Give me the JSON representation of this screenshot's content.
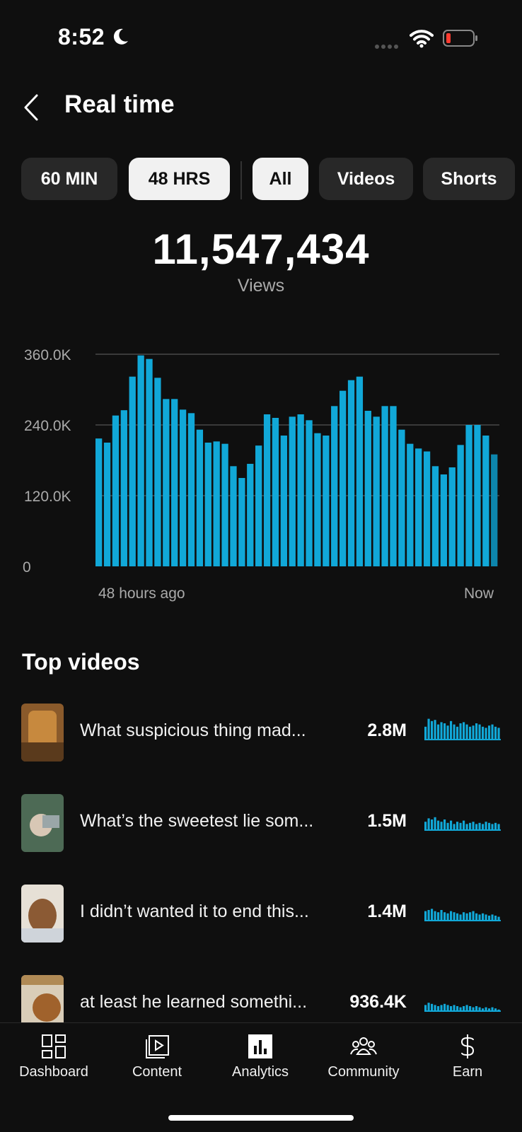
{
  "status_bar": {
    "time": "8:52"
  },
  "header": {
    "title": "Real time"
  },
  "chips": [
    {
      "label": "60 MIN",
      "active": false
    },
    {
      "label": "48 HRS",
      "active": true
    },
    {
      "label": "All",
      "active": true
    },
    {
      "label": "Videos",
      "active": false
    },
    {
      "label": "Shorts",
      "active": false
    }
  ],
  "summary": {
    "value": "11,547,434",
    "label": "Views"
  },
  "chart_data": {
    "type": "bar",
    "y_ticks": [
      "360.0K",
      "240.0K",
      "120.0K",
      "0"
    ],
    "ylim": [
      0,
      360000
    ],
    "x_start_label": "48 hours ago",
    "x_end_label": "Now",
    "grid": true,
    "color": "#11a8d8",
    "values": [
      217000,
      210000,
      256000,
      265000,
      322000,
      358000,
      352000,
      320000,
      284000,
      284000,
      266000,
      260000,
      232000,
      210000,
      212000,
      208000,
      170000,
      150000,
      174000,
      205000,
      258000,
      252000,
      222000,
      254000,
      258000,
      248000,
      226000,
      222000,
      272000,
      298000,
      316000,
      322000,
      264000,
      254000,
      272000,
      272000,
      232000,
      208000,
      200000,
      195000,
      170000,
      156000,
      168000,
      206000,
      240000,
      240000,
      222000,
      190000
    ]
  },
  "top_videos": {
    "title": "Top videos",
    "items": [
      {
        "title": "What suspicious thing mad...",
        "views": "2.8M",
        "spark": [
          0.6,
          0.95,
          0.85,
          0.9,
          0.7,
          0.8,
          0.75,
          0.65,
          0.85,
          0.7,
          0.6,
          0.75,
          0.8,
          0.7,
          0.6,
          0.65,
          0.75,
          0.7,
          0.6,
          0.55,
          0.65,
          0.7,
          0.6,
          0.55
        ]
      },
      {
        "title": "What’s the sweetest lie som...",
        "views": "1.5M",
        "spark": [
          0.4,
          0.55,
          0.5,
          0.6,
          0.45,
          0.4,
          0.5,
          0.35,
          0.45,
          0.3,
          0.4,
          0.35,
          0.45,
          0.3,
          0.35,
          0.4,
          0.3,
          0.35,
          0.3,
          0.4,
          0.35,
          0.3,
          0.35,
          0.3
        ]
      },
      {
        "title": "I didn’t wanted it to end this...",
        "views": "1.4M",
        "spark": [
          0.45,
          0.5,
          0.55,
          0.45,
          0.4,
          0.5,
          0.4,
          0.35,
          0.45,
          0.4,
          0.35,
          0.3,
          0.4,
          0.35,
          0.4,
          0.45,
          0.35,
          0.3,
          0.35,
          0.3,
          0.25,
          0.3,
          0.25,
          0.2
        ]
      },
      {
        "title": "at least he learned somethi...",
        "views": "936.4K",
        "spark": [
          0.3,
          0.4,
          0.35,
          0.3,
          0.25,
          0.3,
          0.35,
          0.3,
          0.25,
          0.3,
          0.25,
          0.2,
          0.25,
          0.3,
          0.25,
          0.2,
          0.25,
          0.2,
          0.15,
          0.2,
          0.15,
          0.2,
          0.15,
          0.1
        ]
      }
    ]
  },
  "nav": [
    {
      "label": "Dashboard",
      "icon": "dashboard-icon"
    },
    {
      "label": "Content",
      "icon": "content-icon"
    },
    {
      "label": "Analytics",
      "icon": "analytics-icon"
    },
    {
      "label": "Community",
      "icon": "community-icon"
    },
    {
      "label": "Earn",
      "icon": "earn-icon"
    }
  ]
}
